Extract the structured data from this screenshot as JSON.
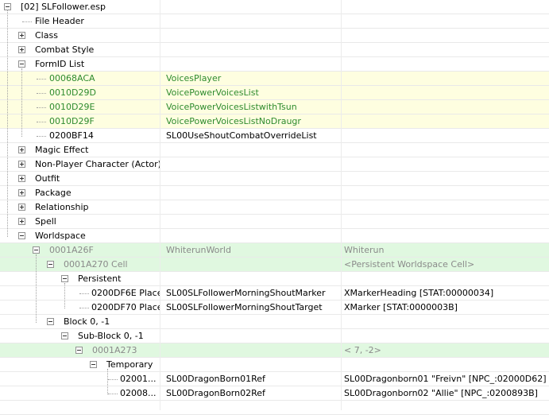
{
  "root": {
    "label": "[02] SLFollower.esp"
  },
  "top_items": [
    {
      "label": "File Header"
    },
    {
      "label": "Class"
    },
    {
      "label": "Combat Style"
    },
    {
      "label": "FormID List"
    }
  ],
  "formid_list": [
    {
      "id": "00068ACA",
      "name": "VoicesPlayer"
    },
    {
      "id": "0010D29D",
      "name": "VoicePowerVoicesList"
    },
    {
      "id": "0010D29E",
      "name": "VoicePowerVoicesListwithTsun"
    },
    {
      "id": "0010D29F",
      "name": "VoicePowerVoicesListNoDraugr"
    },
    {
      "id": "0200BF14",
      "name": "SL00UseShoutCombatOverrideList"
    }
  ],
  "mid_items": [
    {
      "label": "Magic Effect"
    },
    {
      "label": "Non-Player Character (Actor)"
    },
    {
      "label": "Outfit"
    },
    {
      "label": "Package"
    },
    {
      "label": "Relationship"
    },
    {
      "label": "Spell"
    },
    {
      "label": "Worldspace"
    }
  ],
  "worldspace": {
    "world": {
      "id": "0001A26F",
      "editor_id": "WhiterunWorld",
      "name": "Whiterun"
    },
    "cell": {
      "label": "0001A270  Cell",
      "name": "<Persistent Worldspace Cell>"
    },
    "persistent": {
      "label": "Persistent"
    },
    "placed": [
      {
        "label": "0200DF6E  Place",
        "editor_id": "SL00SLFollowerMorningShoutMarker",
        "base": "XMarkerHeading [STAT:00000034]"
      },
      {
        "label": "0200DF70  Place",
        "editor_id": "SL00SLFollowerMorningShoutTarget",
        "base": "XMarker [STAT:0000003B]"
      }
    ],
    "block": {
      "label": "Block 0, -1"
    },
    "subblock": {
      "label": "Sub-Block 0, -1"
    },
    "cell2": {
      "id": "0001A273",
      "grid": "<  7,  -2>"
    },
    "temporary": {
      "label": "Temporary"
    },
    "refs": [
      {
        "label": "02001...",
        "editor_id": "SL00DragonBorn01Ref",
        "base": "SL00Dragonborn01 \"Freivn\" [NPC_:02000D62]"
      },
      {
        "label": "02008...",
        "editor_id": "SL00DragonBorn02Ref",
        "base": "SL00Dragonborn02 \"Allie\" [NPC_:0200893B]"
      }
    ]
  }
}
